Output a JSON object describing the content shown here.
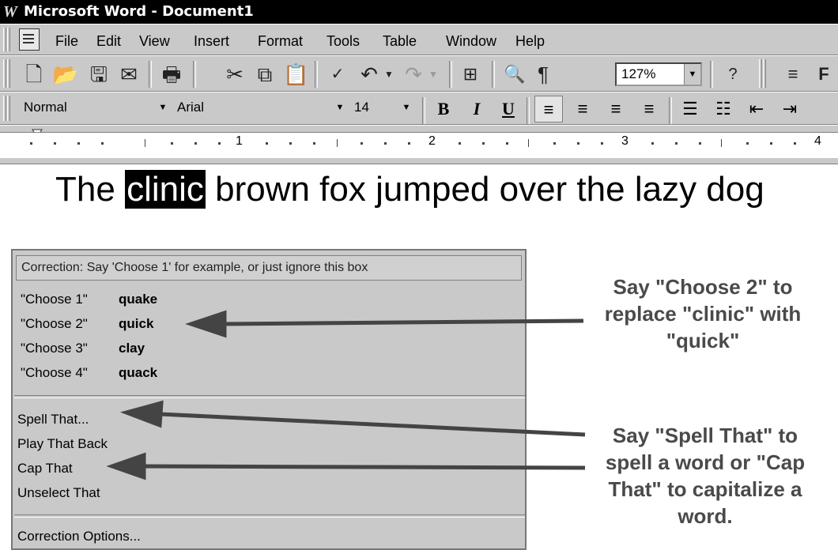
{
  "window": {
    "title": "Microsoft Word - Document1",
    "app_glyph": "W"
  },
  "menu": [
    "File",
    "Edit",
    "View",
    "Insert",
    "Format",
    "Tools",
    "Table",
    "Window",
    "Help"
  ],
  "standard_toolbar": {
    "zoom": "127%",
    "paragraph_mark": "¶",
    "extra": "F"
  },
  "formatting": {
    "style": "Normal",
    "font": "Arial",
    "size": "14",
    "bold": "B",
    "italic": "I",
    "underline": "U"
  },
  "ruler": {
    "numbers": [
      "1",
      "2",
      "3",
      "4"
    ]
  },
  "document": {
    "before": "The",
    "selected": "clinic",
    "after": "brown fox jumped over the lazy dog"
  },
  "correction": {
    "header": "Correction: Say 'Choose 1' for example, or just ignore this box",
    "choices": [
      {
        "label": "\"Choose 1\"",
        "word": "quake"
      },
      {
        "label": "\"Choose 2\"",
        "word": "quick"
      },
      {
        "label": "\"Choose 3\"",
        "word": "clay"
      },
      {
        "label": "\"Choose 4\"",
        "word": "quack"
      }
    ],
    "commands": [
      "Spell That...",
      "Play That Back",
      "Cap That",
      "Unselect That"
    ],
    "options": "Correction Options..."
  },
  "annotations": {
    "choose2": [
      "Say \"Choose 2\" to",
      "replace \"clinic\" with",
      "\"quick\""
    ],
    "spell": [
      "Say \"Spell That\" to",
      "spell a word or \"Cap",
      "That\" to capitalize a",
      "word."
    ]
  }
}
